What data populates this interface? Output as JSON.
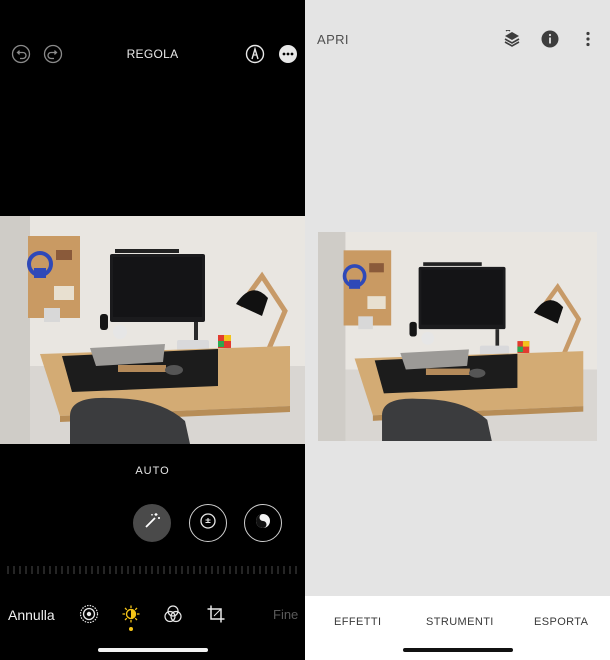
{
  "left_panel": {
    "title": "REGOLA",
    "mode_label": "AUTO",
    "cancel_label": "Annulla",
    "done_label": "Fine",
    "accent_color": "#f5c518",
    "top_icons": [
      "undo-icon",
      "redo-icon",
      "markup-pen-icon",
      "more-options-icon"
    ],
    "adjust_tools": [
      "auto-enhance-wand-icon",
      "exposure-icon",
      "brilliance-icon"
    ],
    "bottom_tabs": [
      "live-icon",
      "adjust-icon",
      "filters-icon",
      "crop-icon"
    ]
  },
  "right_panel": {
    "open_label": "APRI",
    "top_icons": [
      "layers-history-icon",
      "info-icon",
      "more-vertical-icon"
    ],
    "tabs": [
      "EFFETTI",
      "STRUMENTI",
      "ESPORTA"
    ]
  },
  "photo_subject": "desk-setup-photo"
}
